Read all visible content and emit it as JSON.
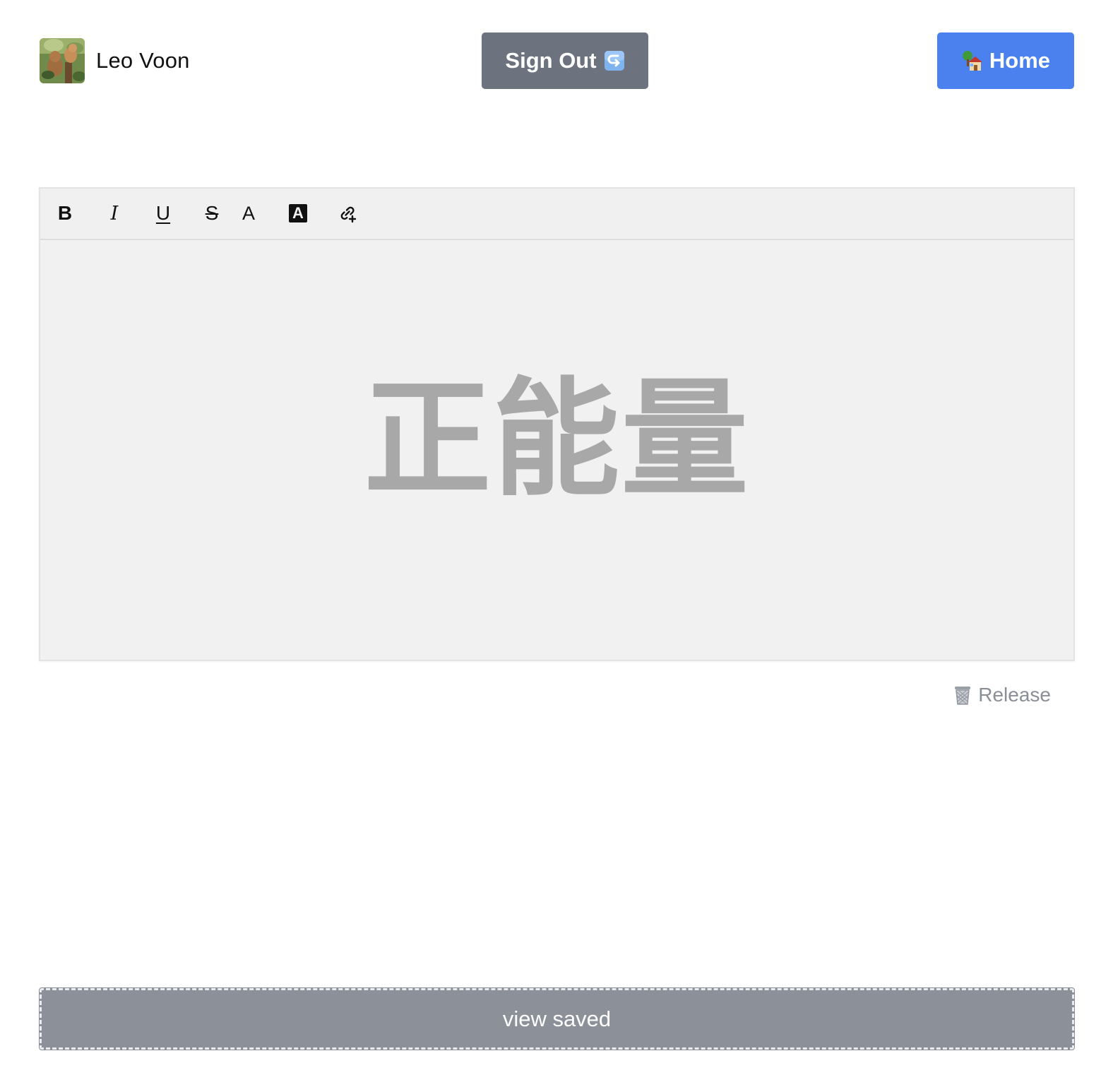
{
  "header": {
    "user_name": "Leo Voon",
    "avatar_icon": "squirrel-photo-avatar",
    "sign_out_label": "Sign Out",
    "sign_out_icon": "return-arrow-icon",
    "home_label": "Home",
    "home_icon": "house-with-tree-icon"
  },
  "toolbar": {
    "bold": "B",
    "italic": "I",
    "underline": "U",
    "strikethrough": "S",
    "font_color": "A",
    "background_color": "A",
    "link_icon": "add-link-icon"
  },
  "editor": {
    "content": "正能量"
  },
  "release": {
    "label": "Release",
    "icon": "wastebasket-icon"
  },
  "view_saved": {
    "label": "view saved"
  },
  "colors": {
    "sign_out_bg": "#6c737f",
    "home_bg": "#4b81ef",
    "editor_bg": "#f1f1f2",
    "editor_text": "#a8a8a8",
    "release_text": "#8a8f97",
    "view_saved_bg": "#8b9099"
  }
}
